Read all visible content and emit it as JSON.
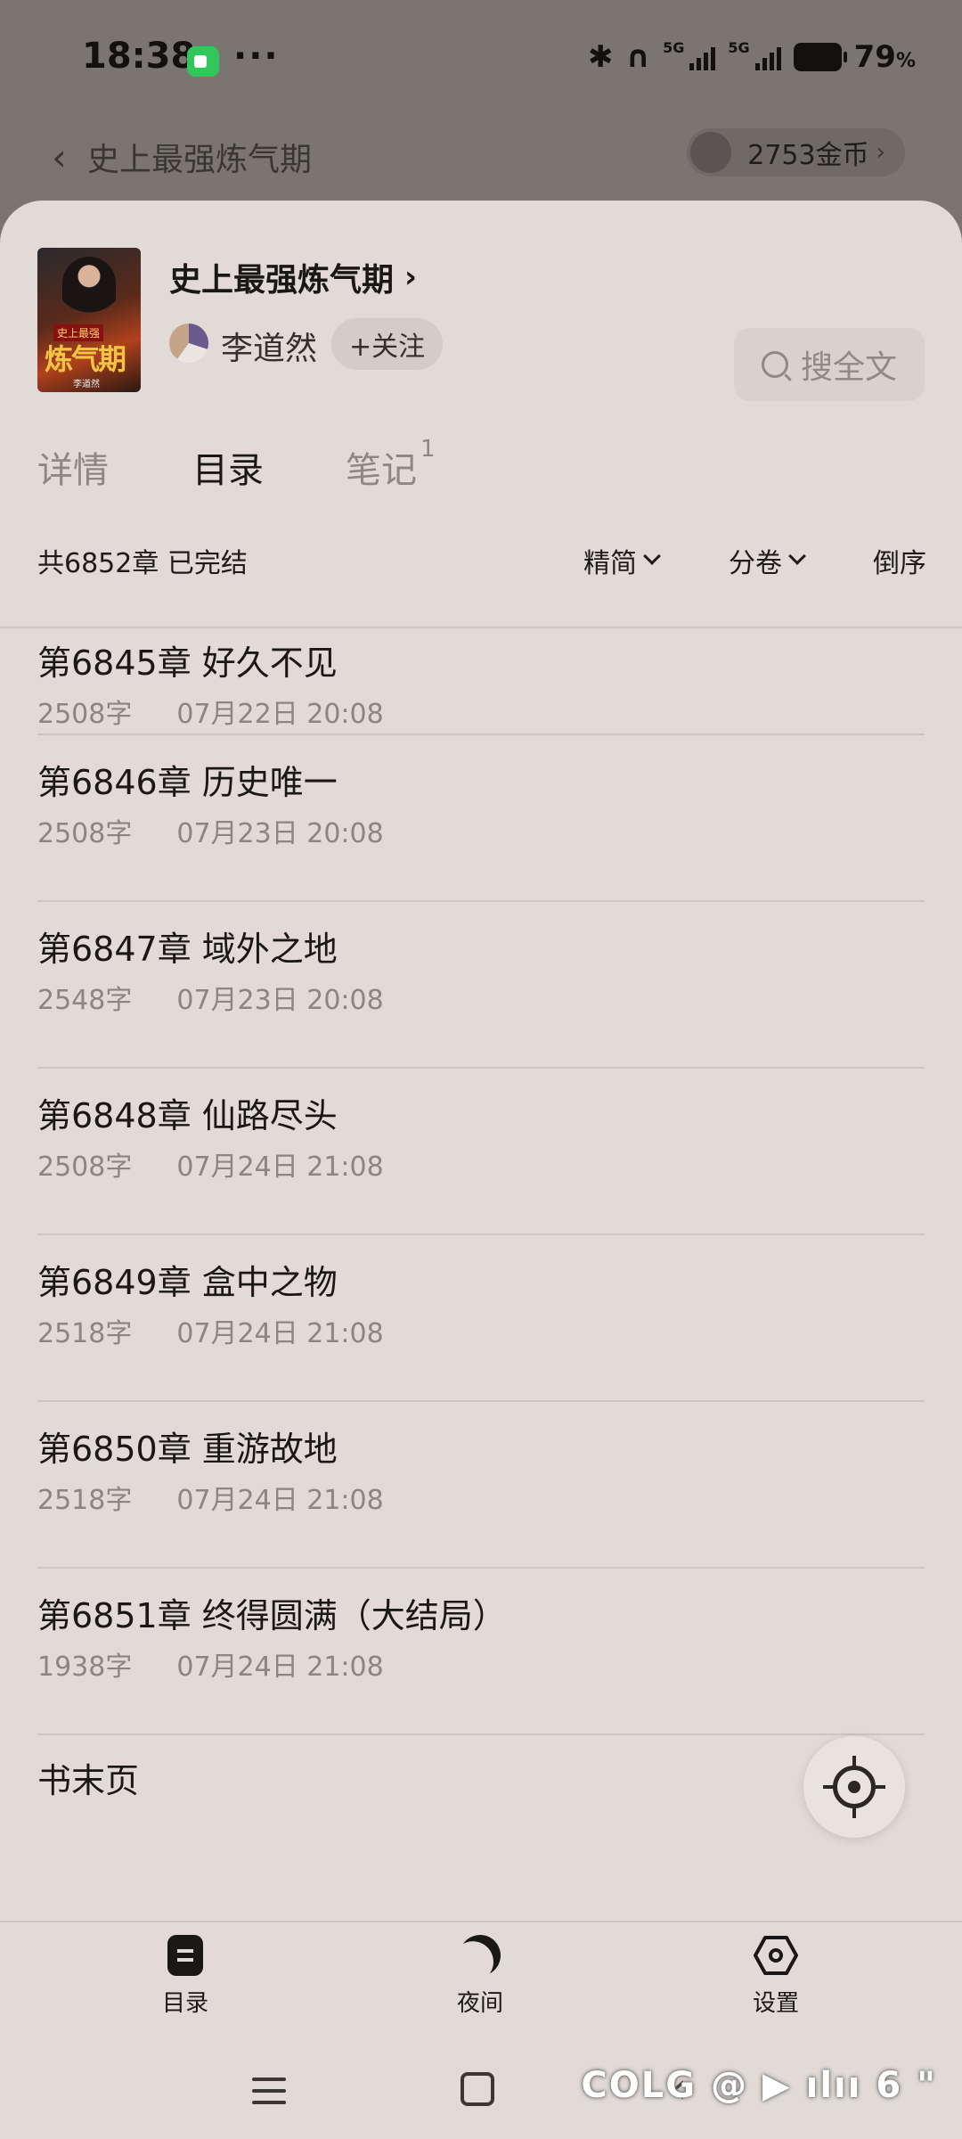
{
  "status_bar": {
    "time": "18:38",
    "dots": "···",
    "battery_pct": "79",
    "battery_unit": "%",
    "net_label_1": "5G",
    "net_label_2": "5G"
  },
  "background": {
    "back_title": "史上最强炼气期",
    "coins_label": "2753金币"
  },
  "book": {
    "cover_series": "史上最强",
    "cover_title": "炼气期",
    "cover_author": "李道然",
    "title": "史上最强炼气期",
    "author": "李道然",
    "follow_label": "+关注",
    "search_label": "搜全文"
  },
  "tabs": [
    {
      "label": "详情",
      "active": false
    },
    {
      "label": "目录",
      "active": true
    },
    {
      "label": "笔记",
      "badge": "1",
      "active": false
    }
  ],
  "toolbar": {
    "chapter_count": "共6852章 已完结",
    "format_label": "精简",
    "volume_label": "分卷",
    "order_label": "倒序"
  },
  "chapters": [
    {
      "title": "第6845章 好久不见",
      "words": "2508字",
      "date": "07月22日 20:08"
    },
    {
      "title": "第6846章 历史唯一",
      "words": "2508字",
      "date": "07月23日 20:08"
    },
    {
      "title": "第6847章 域外之地",
      "words": "2548字",
      "date": "07月23日 20:08"
    },
    {
      "title": "第6848章 仙路尽头",
      "words": "2508字",
      "date": "07月24日 21:08"
    },
    {
      "title": "第6849章 盒中之物",
      "words": "2518字",
      "date": "07月24日 21:08"
    },
    {
      "title": "第6850章 重游故地",
      "words": "2518字",
      "date": "07月24日 21:08"
    },
    {
      "title": "第6851章 终得圆满（大结局）",
      "words": "1938字",
      "date": "07月24日 21:08"
    }
  ],
  "end_page_label": "书末页",
  "bottom_nav": {
    "catalog": "目录",
    "night": "夜间",
    "settings": "设置"
  },
  "watermark": "COLG @ ▶ ılıı 6 \"",
  "icons": {
    "camera": "camera-icon",
    "bluetooth": "bluetooth-icon",
    "headphones": "headphones-icon",
    "signal": "signal-icon",
    "battery": "battery-icon",
    "back": "back-chevron-icon",
    "coin": "coin-icon",
    "search": "search-icon",
    "locate": "locate-icon",
    "catalog": "catalog-icon",
    "night": "moon-icon",
    "settings": "hexagon-settings-icon"
  },
  "colors": {
    "sheet_bg": "#e1dad6",
    "dim_overlay": "#7b7571",
    "text_primary": "#1a1816",
    "text_secondary": "#8c8581",
    "divider": "#cdc6c1"
  }
}
